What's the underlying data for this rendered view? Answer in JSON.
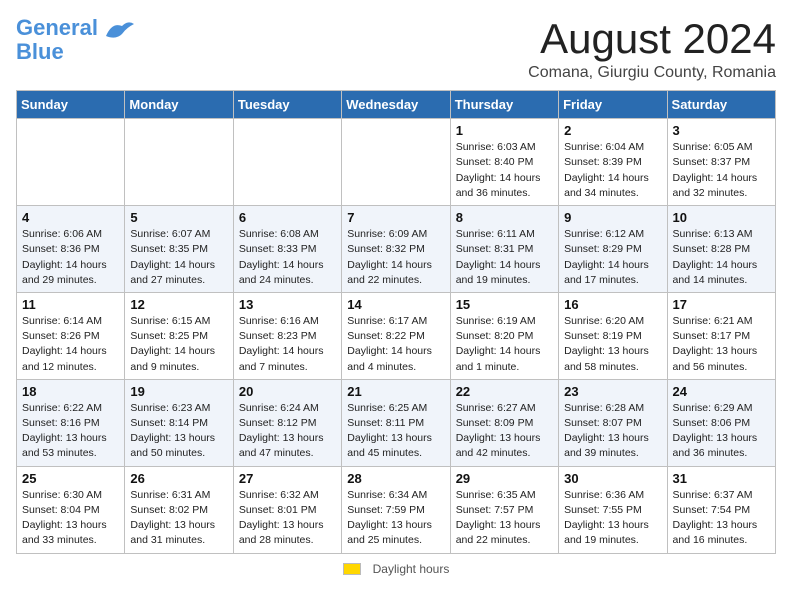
{
  "header": {
    "logo_line1": "General",
    "logo_line2": "Blue",
    "month_title": "August 2024",
    "location": "Comana, Giurgiu County, Romania"
  },
  "weekdays": [
    "Sunday",
    "Monday",
    "Tuesday",
    "Wednesday",
    "Thursday",
    "Friday",
    "Saturday"
  ],
  "weeks": [
    [
      {
        "day": "",
        "info": ""
      },
      {
        "day": "",
        "info": ""
      },
      {
        "day": "",
        "info": ""
      },
      {
        "day": "",
        "info": ""
      },
      {
        "day": "1",
        "info": "Sunrise: 6:03 AM\nSunset: 8:40 PM\nDaylight: 14 hours and 36 minutes."
      },
      {
        "day": "2",
        "info": "Sunrise: 6:04 AM\nSunset: 8:39 PM\nDaylight: 14 hours and 34 minutes."
      },
      {
        "day": "3",
        "info": "Sunrise: 6:05 AM\nSunset: 8:37 PM\nDaylight: 14 hours and 32 minutes."
      }
    ],
    [
      {
        "day": "4",
        "info": "Sunrise: 6:06 AM\nSunset: 8:36 PM\nDaylight: 14 hours and 29 minutes."
      },
      {
        "day": "5",
        "info": "Sunrise: 6:07 AM\nSunset: 8:35 PM\nDaylight: 14 hours and 27 minutes."
      },
      {
        "day": "6",
        "info": "Sunrise: 6:08 AM\nSunset: 8:33 PM\nDaylight: 14 hours and 24 minutes."
      },
      {
        "day": "7",
        "info": "Sunrise: 6:09 AM\nSunset: 8:32 PM\nDaylight: 14 hours and 22 minutes."
      },
      {
        "day": "8",
        "info": "Sunrise: 6:11 AM\nSunset: 8:31 PM\nDaylight: 14 hours and 19 minutes."
      },
      {
        "day": "9",
        "info": "Sunrise: 6:12 AM\nSunset: 8:29 PM\nDaylight: 14 hours and 17 minutes."
      },
      {
        "day": "10",
        "info": "Sunrise: 6:13 AM\nSunset: 8:28 PM\nDaylight: 14 hours and 14 minutes."
      }
    ],
    [
      {
        "day": "11",
        "info": "Sunrise: 6:14 AM\nSunset: 8:26 PM\nDaylight: 14 hours and 12 minutes."
      },
      {
        "day": "12",
        "info": "Sunrise: 6:15 AM\nSunset: 8:25 PM\nDaylight: 14 hours and 9 minutes."
      },
      {
        "day": "13",
        "info": "Sunrise: 6:16 AM\nSunset: 8:23 PM\nDaylight: 14 hours and 7 minutes."
      },
      {
        "day": "14",
        "info": "Sunrise: 6:17 AM\nSunset: 8:22 PM\nDaylight: 14 hours and 4 minutes."
      },
      {
        "day": "15",
        "info": "Sunrise: 6:19 AM\nSunset: 8:20 PM\nDaylight: 14 hours and 1 minute."
      },
      {
        "day": "16",
        "info": "Sunrise: 6:20 AM\nSunset: 8:19 PM\nDaylight: 13 hours and 58 minutes."
      },
      {
        "day": "17",
        "info": "Sunrise: 6:21 AM\nSunset: 8:17 PM\nDaylight: 13 hours and 56 minutes."
      }
    ],
    [
      {
        "day": "18",
        "info": "Sunrise: 6:22 AM\nSunset: 8:16 PM\nDaylight: 13 hours and 53 minutes."
      },
      {
        "day": "19",
        "info": "Sunrise: 6:23 AM\nSunset: 8:14 PM\nDaylight: 13 hours and 50 minutes."
      },
      {
        "day": "20",
        "info": "Sunrise: 6:24 AM\nSunset: 8:12 PM\nDaylight: 13 hours and 47 minutes."
      },
      {
        "day": "21",
        "info": "Sunrise: 6:25 AM\nSunset: 8:11 PM\nDaylight: 13 hours and 45 minutes."
      },
      {
        "day": "22",
        "info": "Sunrise: 6:27 AM\nSunset: 8:09 PM\nDaylight: 13 hours and 42 minutes."
      },
      {
        "day": "23",
        "info": "Sunrise: 6:28 AM\nSunset: 8:07 PM\nDaylight: 13 hours and 39 minutes."
      },
      {
        "day": "24",
        "info": "Sunrise: 6:29 AM\nSunset: 8:06 PM\nDaylight: 13 hours and 36 minutes."
      }
    ],
    [
      {
        "day": "25",
        "info": "Sunrise: 6:30 AM\nSunset: 8:04 PM\nDaylight: 13 hours and 33 minutes."
      },
      {
        "day": "26",
        "info": "Sunrise: 6:31 AM\nSunset: 8:02 PM\nDaylight: 13 hours and 31 minutes."
      },
      {
        "day": "27",
        "info": "Sunrise: 6:32 AM\nSunset: 8:01 PM\nDaylight: 13 hours and 28 minutes."
      },
      {
        "day": "28",
        "info": "Sunrise: 6:34 AM\nSunset: 7:59 PM\nDaylight: 13 hours and 25 minutes."
      },
      {
        "day": "29",
        "info": "Sunrise: 6:35 AM\nSunset: 7:57 PM\nDaylight: 13 hours and 22 minutes."
      },
      {
        "day": "30",
        "info": "Sunrise: 6:36 AM\nSunset: 7:55 PM\nDaylight: 13 hours and 19 minutes."
      },
      {
        "day": "31",
        "info": "Sunrise: 6:37 AM\nSunset: 7:54 PM\nDaylight: 13 hours and 16 minutes."
      }
    ]
  ],
  "footer": {
    "daylight_label": "Daylight hours"
  }
}
